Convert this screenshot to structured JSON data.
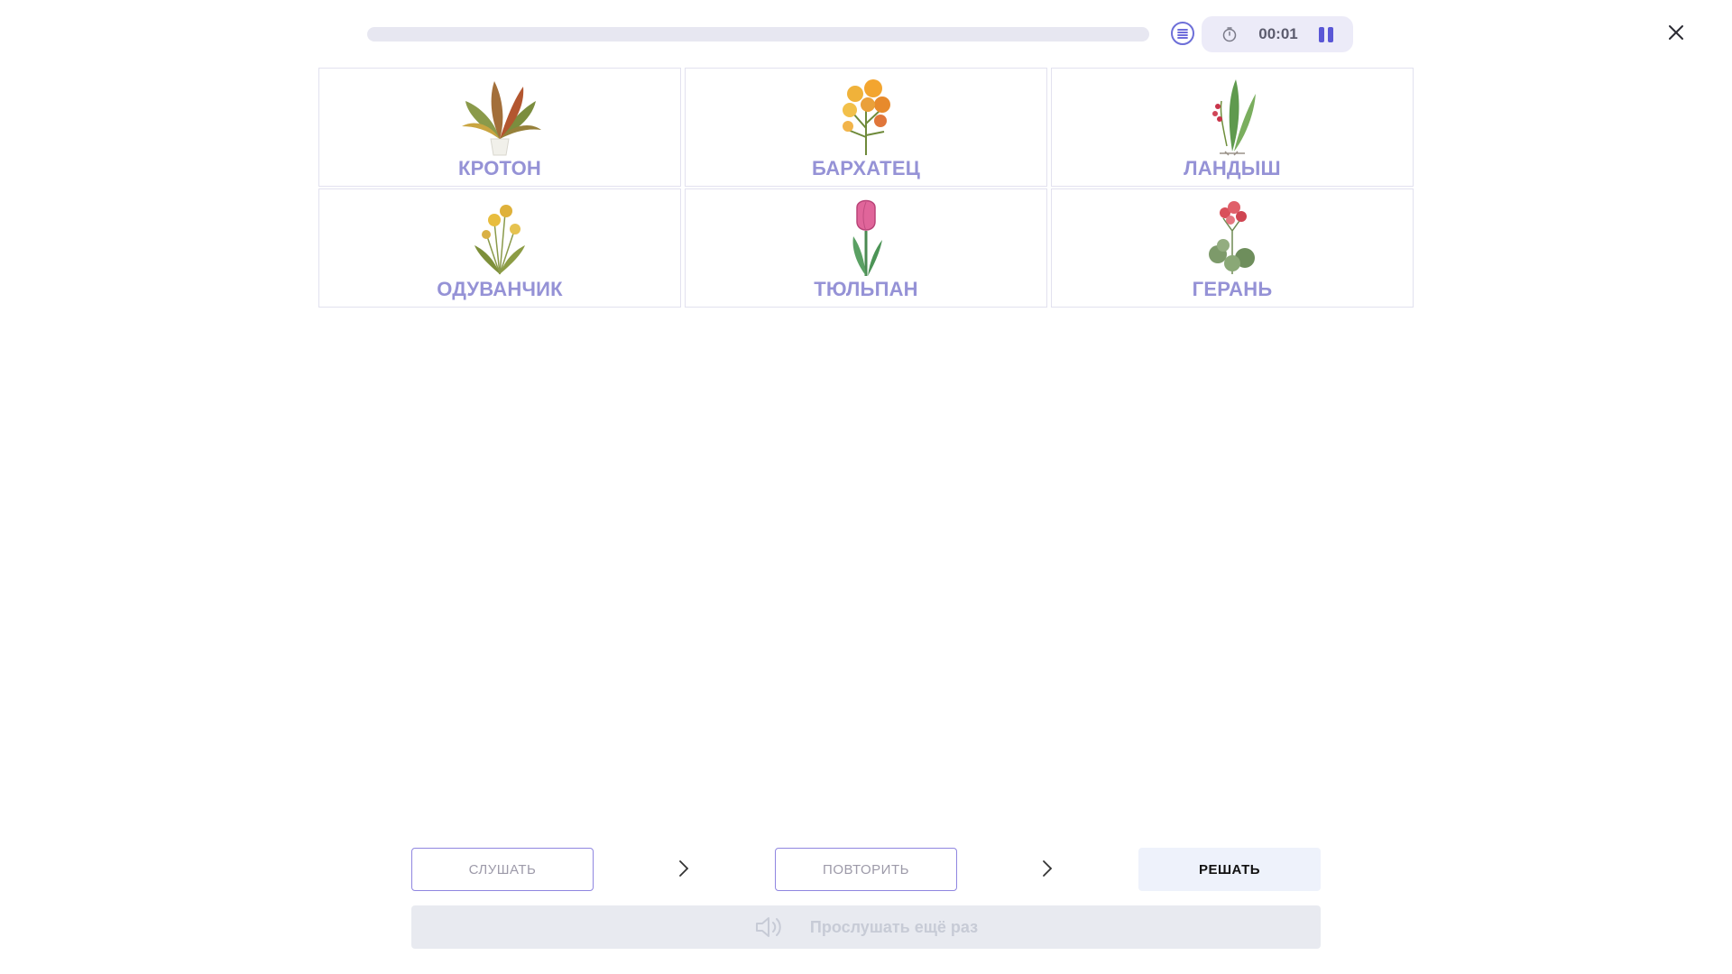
{
  "header": {
    "progress_percent": 0,
    "timer": "00:01"
  },
  "cards": [
    {
      "label": "КРОТОН",
      "icon": "croton-plant-icon"
    },
    {
      "label": "БАРХАТЕЦ",
      "icon": "marigold-flower-icon"
    },
    {
      "label": "ЛАНДЫШ",
      "icon": "lily-of-the-valley-icon"
    },
    {
      "label": "ОДУВАНЧИК",
      "icon": "dandelion-icon"
    },
    {
      "label": "ТЮЛЬПАН",
      "icon": "tulip-icon"
    },
    {
      "label": "ГЕРАНЬ",
      "icon": "geranium-icon"
    }
  ],
  "steps": {
    "listen": "СЛУШАТЬ",
    "repeat": "ПОВТОРИТЬ",
    "solve": "РЕШАТЬ"
  },
  "replay": {
    "label": "Прослушать ещё раз"
  },
  "colors": {
    "accent": "#5a57d6",
    "card_label": "#9592d6",
    "card_border": "#e2e1ef"
  }
}
